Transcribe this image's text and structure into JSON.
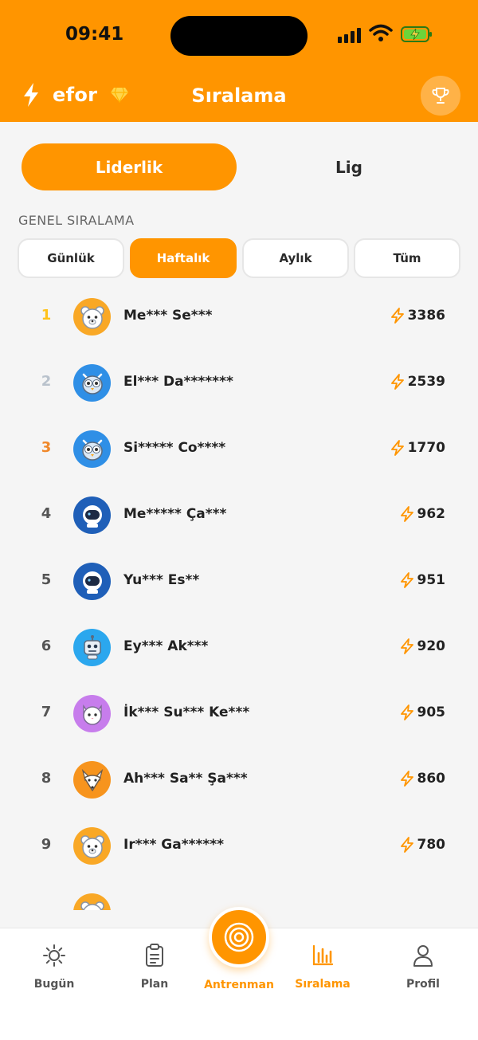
{
  "status_bar": {
    "time": "09:41"
  },
  "header": {
    "brand": "efor",
    "title": "Sıralama"
  },
  "segments": [
    {
      "label": "Liderlik",
      "active": true
    },
    {
      "label": "Lig",
      "active": false
    }
  ],
  "section_label": "GENEL SIRALAMA",
  "filters": [
    {
      "label": "Günlük",
      "active": false
    },
    {
      "label": "Haftalık",
      "active": true
    },
    {
      "label": "Aylık",
      "active": false
    },
    {
      "label": "Tüm",
      "active": false
    }
  ],
  "colors": {
    "accent": "#ff9500",
    "gold": "#ffc21a",
    "silver": "#b9c2cc",
    "bronze": "#f0882a"
  },
  "leaderboard": [
    {
      "rank": "1",
      "name": "Me*** Se***",
      "score": "3386",
      "avatar": "bear-avatar-icon"
    },
    {
      "rank": "2",
      "name": "El*** Da*******",
      "score": "2539",
      "avatar": "owl-avatar-icon"
    },
    {
      "rank": "3",
      "name": "Si***** Co****",
      "score": "1770",
      "avatar": "owl-avatar-icon"
    },
    {
      "rank": "4",
      "name": "Me***** Ça***",
      "score": "962",
      "avatar": "astronaut-avatar-icon"
    },
    {
      "rank": "5",
      "name": "Yu*** Es**",
      "score": "951",
      "avatar": "astronaut-avatar-icon"
    },
    {
      "rank": "6",
      "name": "Ey*** Ak***",
      "score": "920",
      "avatar": "robot-avatar-icon"
    },
    {
      "rank": "7",
      "name": "İk*** Su*** Ke***",
      "score": "905",
      "avatar": "cat-avatar-icon"
    },
    {
      "rank": "8",
      "name": "Ah*** Sa** Şa***",
      "score": "860",
      "avatar": "fox-avatar-icon"
    },
    {
      "rank": "9",
      "name": "Ir*** Ga******",
      "score": "780",
      "avatar": "bear-avatar-icon"
    }
  ],
  "nav": {
    "items": [
      {
        "label": "Bugün",
        "icon": "sun-icon"
      },
      {
        "label": "Plan",
        "icon": "clipboard-icon"
      },
      {
        "label": "Antrenman",
        "icon": "target-icon"
      },
      {
        "label": "Sıralama",
        "icon": "bar-chart-icon"
      },
      {
        "label": "Profil",
        "icon": "user-icon"
      }
    ],
    "active": "Sıralama"
  }
}
